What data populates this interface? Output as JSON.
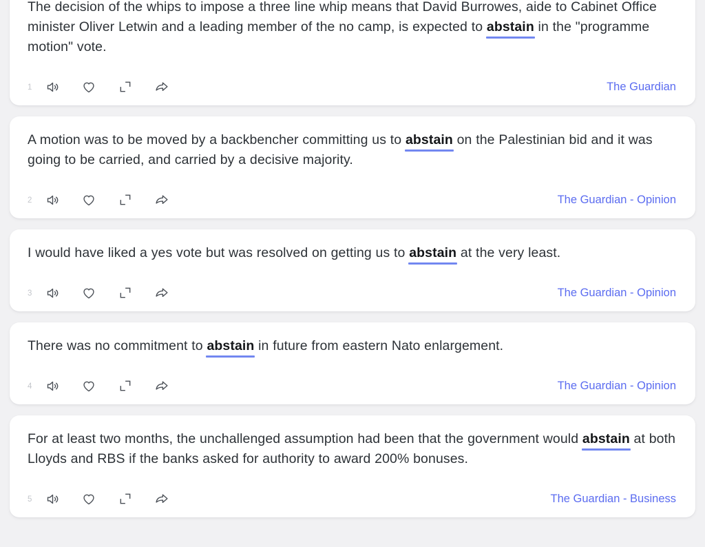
{
  "theme": {
    "page_background": "#f1f1f3",
    "card_background": "#ffffff",
    "text_color": "#2d3237",
    "keyword_underline_color": "#7287f0",
    "source_link_color": "#5b6cf0",
    "index_color": "#c3c6cb",
    "icon_color": "#4b5057"
  },
  "keyword": "abstain",
  "actions": {
    "listen_label": "speaker-icon",
    "favorite_label": "heart-icon",
    "expand_label": "expand-icon",
    "share_label": "share-icon"
  },
  "results": [
    {
      "index": "1",
      "before": "The decision of the whips to impose a three line whip means that David Burrowes, aide to Cabinet Office minister Oliver Letwin and a leading member of the no camp, is expected to ",
      "keyword": "abstain",
      "after": " in the \"programme motion\" vote.",
      "source": "The Guardian"
    },
    {
      "index": "2",
      "before": "A motion was to be moved by a backbencher committing us to ",
      "keyword": "abstain",
      "after": " on the Palestinian bid and it was going to be carried, and carried by a decisive majority.",
      "source": "The Guardian - Opinion"
    },
    {
      "index": "3",
      "before": "I would have liked a yes vote but was resolved on getting us to ",
      "keyword": "abstain",
      "after": " at the very least.",
      "source": "The Guardian - Opinion"
    },
    {
      "index": "4",
      "before": "There was no commitment to ",
      "keyword": "abstain",
      "after": " in future from eastern Nato enlargement.",
      "source": "The Guardian - Opinion"
    },
    {
      "index": "5",
      "before": "For at least two months, the unchallenged assumption had been that the government would ",
      "keyword": "abstain",
      "after": " at both Lloyds and RBS if the banks asked for authority to award 200% bonuses.",
      "source": "The Guardian - Business"
    }
  ]
}
